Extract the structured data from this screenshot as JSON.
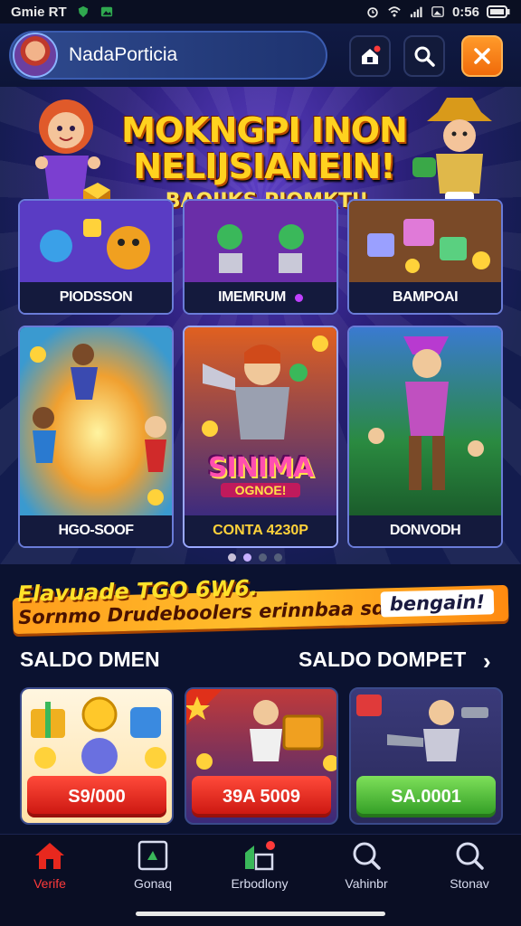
{
  "status_bar": {
    "time_label": "Gmie RT",
    "right_text": "0:56"
  },
  "header": {
    "username": "NadaPorticia"
  },
  "banner": {
    "title": "MOKNGPI INON NELIJSIANEIN!",
    "subtitle": "BAOIIKS PIOMKTI!",
    "top_cards": [
      "PIODSSON",
      "IMEMRUM",
      "BAMPOAI"
    ],
    "bottom_cards": [
      "HGO-SOOF",
      "CONTA 4230P",
      "DONVODH"
    ],
    "center_art_title": "SINIMA",
    "center_art_subtitle": "OGNOE!",
    "carousel_dots": 4,
    "carousel_active_dot": 1
  },
  "promo": {
    "line1": "Elavuade TGO 6W6.",
    "line2": "Sornmo Drudeboolers erinnbaa sdil",
    "tag": "bengain!"
  },
  "saldo": {
    "left_title": "SALDO DMEN",
    "right_title": "SALDO DOMPET",
    "wallets": [
      {
        "amount": "S9/000",
        "color": "red"
      },
      {
        "amount": "39A 5009",
        "color": "red"
      },
      {
        "amount": "SA.0001",
        "color": "green"
      }
    ]
  },
  "nav": {
    "items": [
      "Verife",
      "Gonaq",
      "Erbodlony",
      "Vahinbr",
      "Stonav"
    ],
    "active_index": 0
  },
  "colors": {
    "accent_orange": "#f06a0a",
    "active_red": "#ff3a3a",
    "gold": "#ffd21f"
  }
}
